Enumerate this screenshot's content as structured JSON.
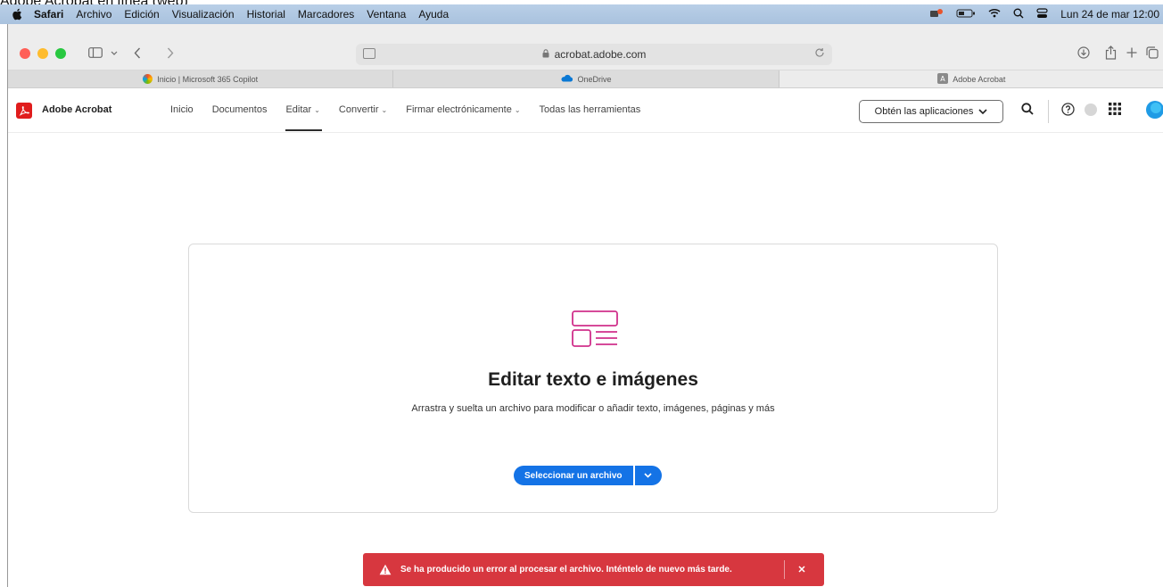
{
  "caption": "Adobe Acrobat en línea (web)",
  "menubar": {
    "items": [
      "Safari",
      "Archivo",
      "Edición",
      "Visualización",
      "Historial",
      "Marcadores",
      "Ventana",
      "Ayuda"
    ],
    "datetime": "Lun 24 de mar  12:00"
  },
  "browser": {
    "url": "acrobat.adobe.com",
    "tabs": [
      {
        "label": "Inicio | Microsoft 365 Copilot"
      },
      {
        "label": "OneDrive"
      },
      {
        "label": "Adobe Acrobat"
      }
    ]
  },
  "appnav": {
    "brand": "Adobe Acrobat",
    "links": [
      "Inicio",
      "Documentos",
      "Editar",
      "Convertir",
      "Firmar electrónicamente",
      "Todas las herramientas"
    ],
    "get_apps": "Obtén las aplicaciones"
  },
  "card": {
    "title": "Editar texto e imágenes",
    "subtitle": "Arrastra y suelta un archivo para modificar o añadir texto, imágenes, páginas y más",
    "select_button": "Seleccionar un archivo"
  },
  "toast": {
    "message": "Se ha producido un error al procesar el archivo. Inténtelo de nuevo más tarde."
  },
  "colors": {
    "accent": "#1473e6",
    "error": "#d7373f",
    "brand_red": "#e01c1c",
    "illustration": "#d0308b"
  }
}
